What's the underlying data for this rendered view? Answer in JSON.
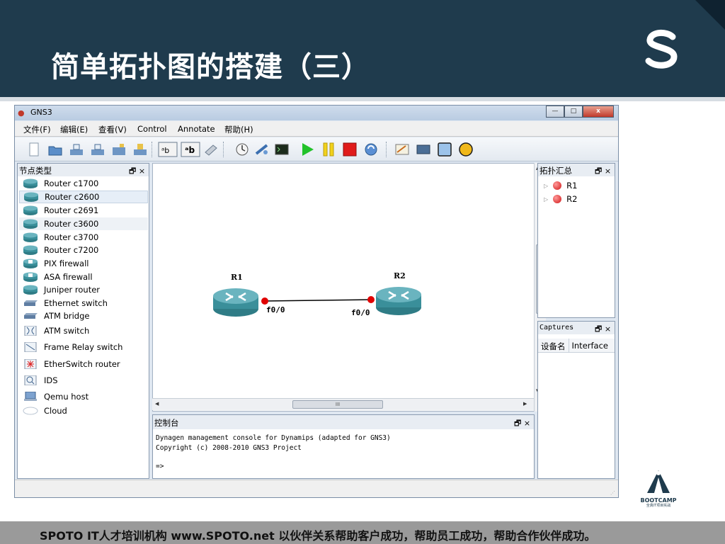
{
  "slide": {
    "title": "简单拓扑图的搭建（三）",
    "footer": "SPOTO IT人才培训机构   www.SPOTO.net   以伙伴关系帮助客户成功，帮助员工成功，帮助合作伙伴成功。",
    "logo_letter": "S",
    "badge_name": "BOOTCAMP",
    "badge_sub": "全真IT项目实战",
    "colors": {
      "header": "#1f3b4d",
      "footer": "#9a9a9a"
    }
  },
  "window": {
    "title": "GNS3",
    "buttons": {
      "minimize": "—",
      "maximize": "□",
      "close": "x"
    }
  },
  "menu": [
    "文件(F)",
    "编辑(E)",
    "查看(V)",
    "Control",
    "Annotate",
    "帮助(H)"
  ],
  "toolbar_icons": [
    "new-icon",
    "open-icon",
    "save-icon",
    "save-as-icon",
    "open-folder-icon",
    "import-icon",
    "show-hostnames-icon",
    "show-interfaces-icon",
    "add-link-icon",
    "timer-icon",
    "telnet-all-icon",
    "console-icon",
    "start-icon",
    "pause-icon",
    "stop-icon",
    "reload-icon",
    "note-icon",
    "screenshot-icon",
    "rectangle-icon",
    "ellipse-icon"
  ],
  "node_types": {
    "title": "节点类型",
    "controls": "🗗 ×",
    "items": [
      {
        "label": "Router c1700",
        "icon": "router-icon"
      },
      {
        "label": "Router c2600",
        "icon": "router-icon"
      },
      {
        "label": "Router c2691",
        "icon": "router-icon"
      },
      {
        "label": "Router c3600",
        "icon": "router-icon"
      },
      {
        "label": "Router c3700",
        "icon": "router-icon"
      },
      {
        "label": "Router c7200",
        "icon": "router-icon"
      },
      {
        "label": "PIX firewall",
        "icon": "firewall-icon"
      },
      {
        "label": "ASA firewall",
        "icon": "firewall-icon"
      },
      {
        "label": "Juniper router",
        "icon": "router-icon"
      },
      {
        "label": "Ethernet switch",
        "icon": "switch-icon"
      },
      {
        "label": "ATM bridge",
        "icon": "bridge-icon"
      },
      {
        "label": "ATM switch",
        "icon": "atm-switch-icon"
      },
      {
        "label": "Frame Relay switch",
        "icon": "frame-relay-icon"
      },
      {
        "label": "EtherSwitch router",
        "icon": "etherswitch-icon"
      },
      {
        "label": "IDS",
        "icon": "ids-icon"
      },
      {
        "label": "Qemu host",
        "icon": "host-icon"
      },
      {
        "label": "Cloud",
        "icon": "cloud-icon"
      }
    ]
  },
  "topology": {
    "routers": [
      {
        "name": "R1",
        "interface": "f0/0"
      },
      {
        "name": "R2",
        "interface": "f0/0"
      }
    ],
    "hscroll_grip": "III"
  },
  "topology_summary": {
    "title": "拓扑汇总",
    "controls": "🗗 ×",
    "items": [
      {
        "label": "R1",
        "status": "stopped"
      },
      {
        "label": "R2",
        "status": "stopped"
      }
    ]
  },
  "captures": {
    "title": "Captures",
    "controls": "🗗 ×",
    "columns": [
      "设备名",
      "Interface"
    ]
  },
  "console": {
    "title": "控制台",
    "controls": "🗗 ×",
    "line1": "Dynagen management console for Dynamips (adapted for GNS3)",
    "line2": "Copyright (c) 2008-2010 GNS3 Project",
    "prompt": "=>"
  }
}
